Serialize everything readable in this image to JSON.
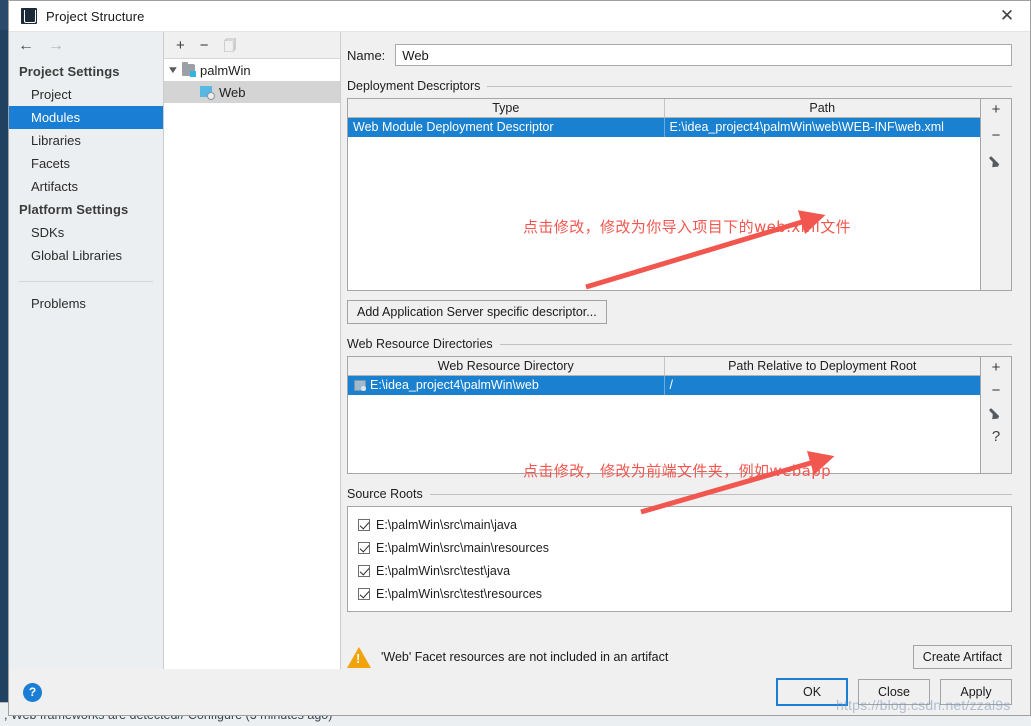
{
  "window": {
    "title": "Project Structure",
    "app_icon": "intellij-idea-icon",
    "close_label": "✕"
  },
  "background": {
    "status_text": ", Web frameworks are detected// Configure (3 minutes ago)"
  },
  "nav": {
    "back_icon": "←",
    "forward_icon": "→",
    "sections": [
      {
        "header": "Project Settings",
        "items": [
          {
            "label": "Project",
            "selected": false
          },
          {
            "label": "Modules",
            "selected": true
          },
          {
            "label": "Libraries",
            "selected": false
          },
          {
            "label": "Facets",
            "selected": false
          },
          {
            "label": "Artifacts",
            "selected": false
          }
        ]
      },
      {
        "header": "Platform Settings",
        "items": [
          {
            "label": "SDKs",
            "selected": false
          },
          {
            "label": "Global Libraries",
            "selected": false
          }
        ]
      }
    ],
    "problems_label": "Problems"
  },
  "tree": {
    "toolbar": {
      "add": "+",
      "remove": "−",
      "copy_icon": "copy-icon"
    },
    "nodes": [
      {
        "label": "palmWin",
        "icon": "module-icon",
        "expanded": true,
        "selected": false
      },
      {
        "label": "Web",
        "icon": "web-facet-icon",
        "selected": true
      }
    ]
  },
  "main": {
    "name_label": "Name:",
    "name_value": "Web",
    "deployment": {
      "group_title": "Deployment Descriptors",
      "columns": [
        "Type",
        "Path"
      ],
      "rows": [
        {
          "type": "Web Module Deployment Descriptor",
          "path": "E:\\idea_project4\\palmWin\\web\\WEB-INF\\web.xml",
          "selected": true
        }
      ],
      "tools": [
        "+",
        "−",
        "edit-pencil-icon"
      ],
      "add_descriptor_button": "Add Application Server specific descriptor..."
    },
    "web_resources": {
      "group_title": "Web Resource Directories",
      "columns": [
        "Web Resource Directory",
        "Path Relative to Deployment Root"
      ],
      "rows": [
        {
          "directory": "E:\\idea_project4\\palmWin\\web",
          "relative_path": "/",
          "selected": true
        }
      ],
      "tools": [
        "+",
        "−",
        "edit-pencil-icon",
        "?"
      ]
    },
    "source_roots": {
      "group_title": "Source Roots",
      "items": [
        {
          "path": "E:\\palmWin\\src\\main\\java",
          "checked": true
        },
        {
          "path": "E:\\palmWin\\src\\main\\resources",
          "checked": true
        },
        {
          "path": "E:\\palmWin\\src\\test\\java",
          "checked": true
        },
        {
          "path": "E:\\palmWin\\src\\test\\resources",
          "checked": true
        }
      ]
    },
    "warning": {
      "icon": "warning-triangle-icon",
      "text": "'Web' Facet resources are not included in an artifact",
      "action_button": "Create Artifact"
    }
  },
  "footer": {
    "help_icon": "?",
    "ok": "OK",
    "close": "Close",
    "apply": "Apply"
  },
  "annotations": [
    {
      "text": "点击修改，修改为你导入项目下的web.xml文件"
    },
    {
      "text": "点击修改，修改为前端文件夹，例如webapp"
    }
  ],
  "watermark": "https://blog.csdn.net/zzal9s",
  "colors": {
    "accent_blue": "#1a7fd4",
    "selection_blue": "#1a80d0",
    "annotation_red": "#f2574f",
    "warning_amber": "#f0a30a"
  }
}
